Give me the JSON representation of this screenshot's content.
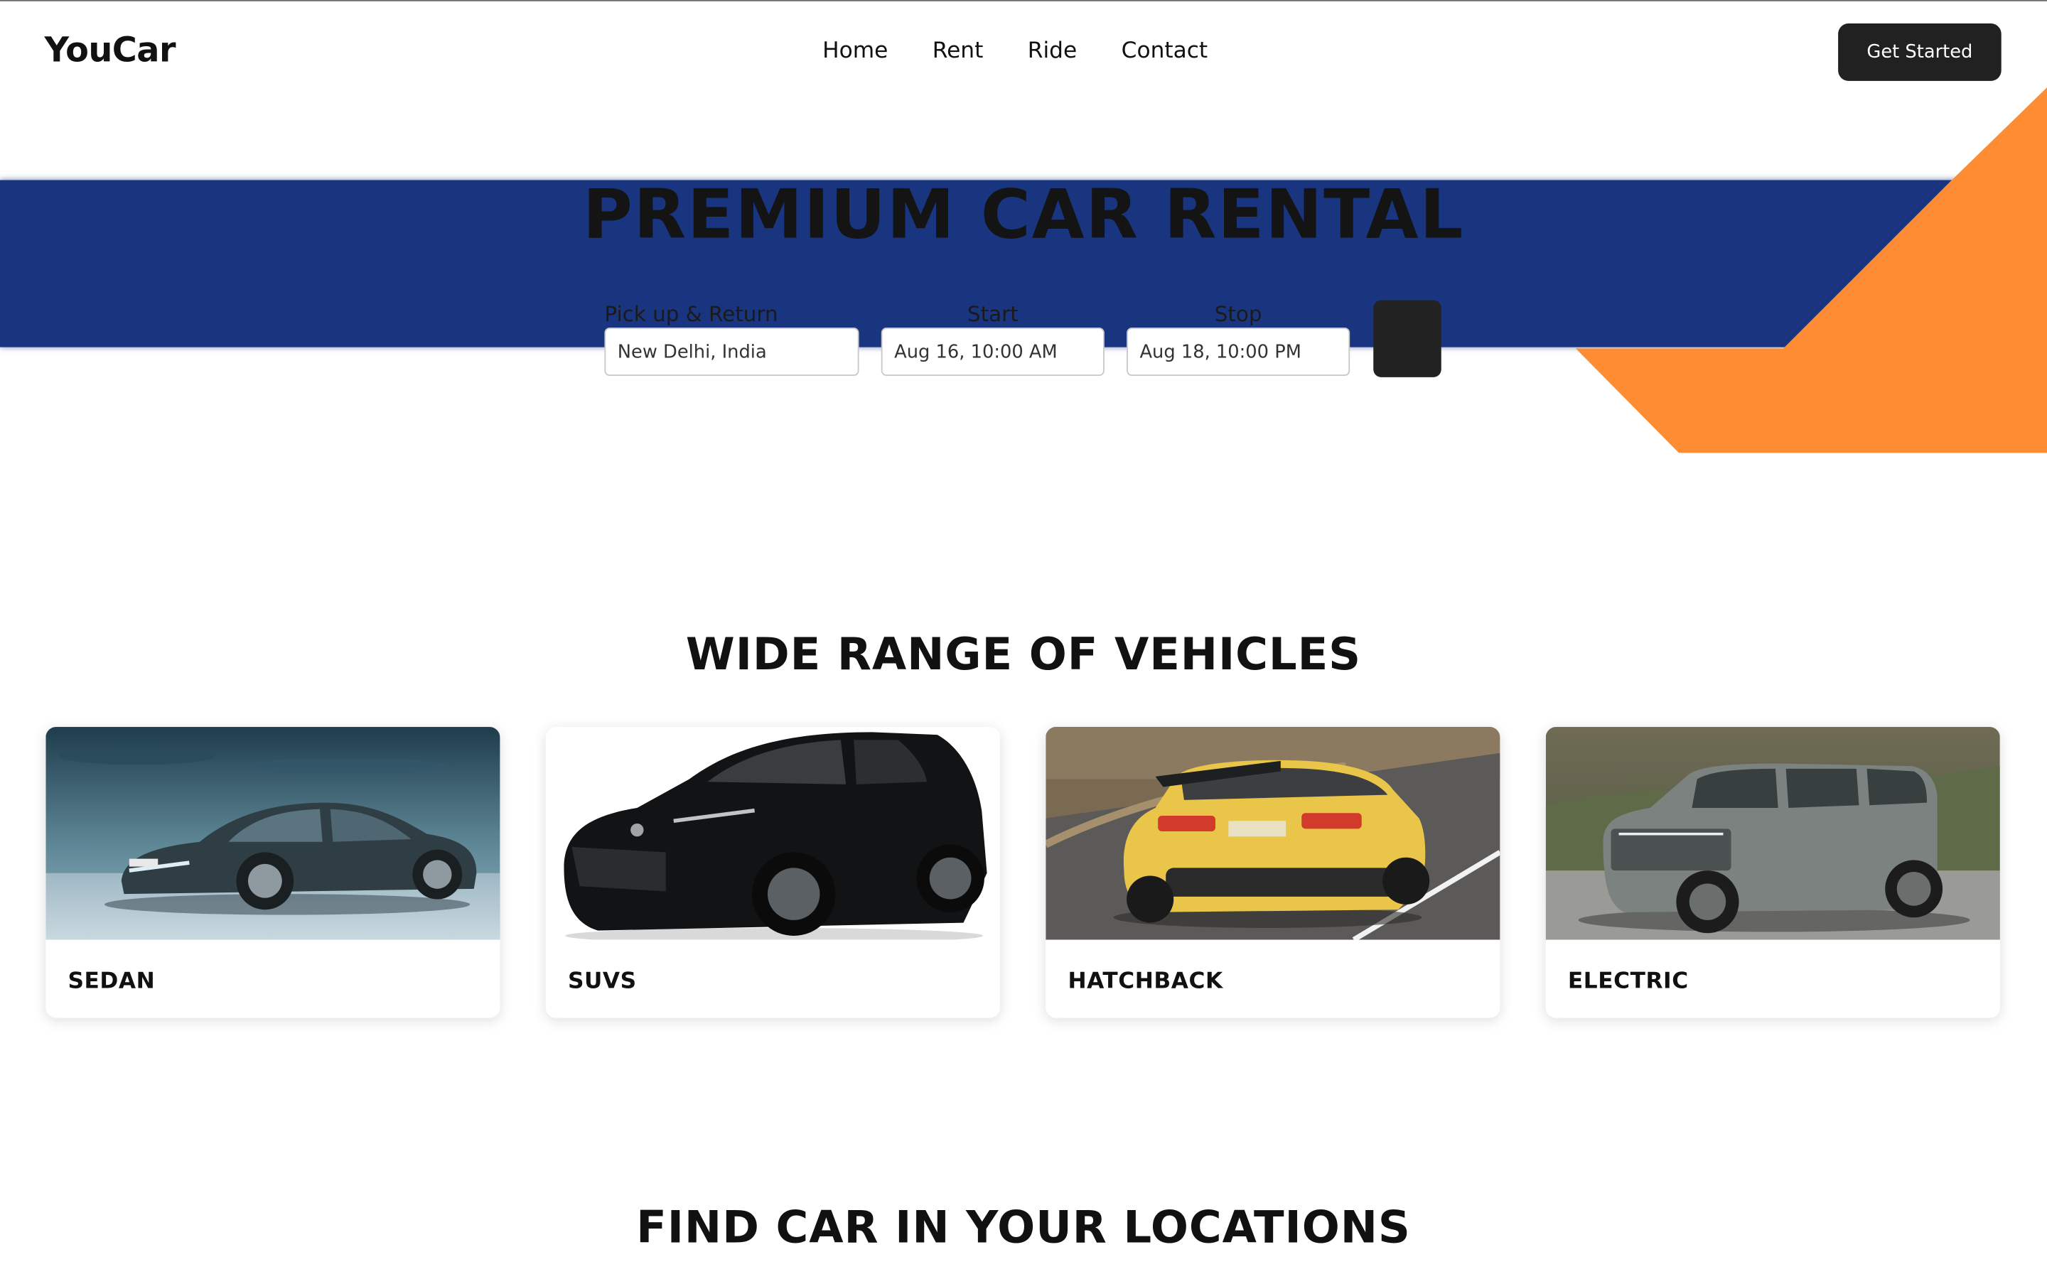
{
  "header": {
    "brand": "YouCar",
    "nav": [
      "Home",
      "Rent",
      "Ride",
      "Contact"
    ],
    "cta_label": "Get Started"
  },
  "hero": {
    "title": "PREMIUM CAR RENTAL",
    "location_label": "Pick up & Return location",
    "location_value": "New Delhi, India",
    "start_label": "Start",
    "start_value": "Aug 16, 10:00 AM",
    "stop_label": "Stop",
    "stop_value": "Aug 18, 10:00 PM"
  },
  "vehicles": {
    "title": "WIDE RANGE OF VEHICLES",
    "cards": [
      {
        "label": "SEDAN"
      },
      {
        "label": "SUVS"
      },
      {
        "label": "HATCHBACK"
      },
      {
        "label": "ELECTRIC"
      }
    ]
  },
  "locations": {
    "title": "FIND CAR IN YOUR LOCATIONS"
  },
  "colors": {
    "band": "#193580",
    "accent": "#fd8c33",
    "button": "#212121"
  }
}
